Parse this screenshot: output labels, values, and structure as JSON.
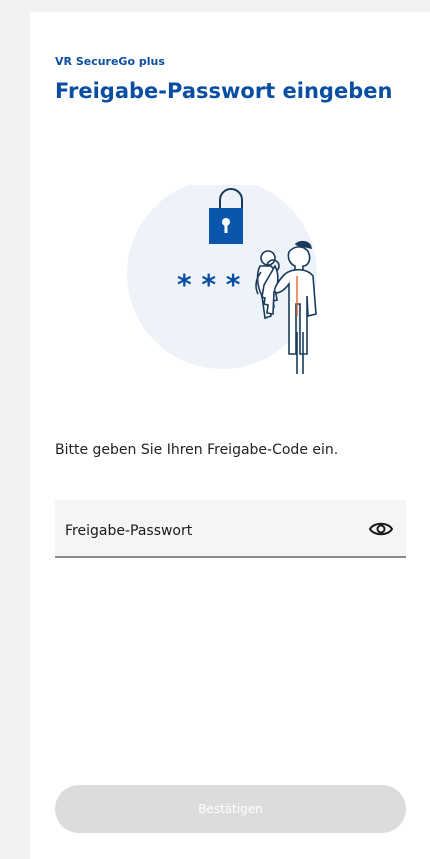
{
  "header": {
    "app_name": "VR SecureGo plus",
    "title": "Freigabe-Passwort eingeben"
  },
  "illustration": {
    "icon": "lock-keys-person-illustration",
    "password_mask": "* * *"
  },
  "instruction": "Bitte geben Sie Ihren Freigabe-Code ein.",
  "password_field": {
    "placeholder": "Freigabe-Passwort",
    "value": "",
    "toggle_icon": "eye-icon"
  },
  "confirm_button": {
    "label": "Bestätigen",
    "enabled": false
  },
  "colors": {
    "brand_blue": "#0a4ea2",
    "illustration_bg": "#eef3f9",
    "disabled_button": "#dcdcdc"
  }
}
